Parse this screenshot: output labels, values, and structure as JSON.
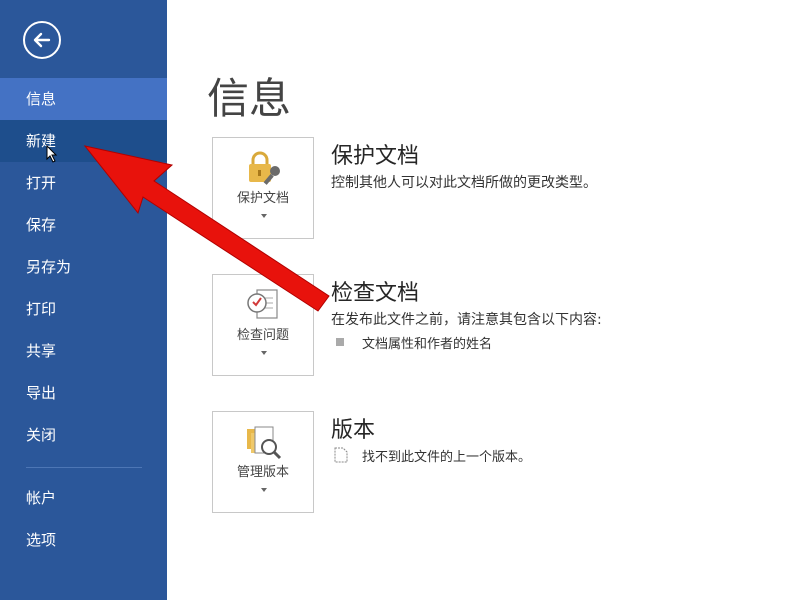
{
  "sidebar": {
    "items": [
      {
        "label": "信息"
      },
      {
        "label": "新建"
      },
      {
        "label": "打开"
      },
      {
        "label": "保存"
      },
      {
        "label": "另存为"
      },
      {
        "label": "打印"
      },
      {
        "label": "共享"
      },
      {
        "label": "导出"
      },
      {
        "label": "关闭"
      },
      {
        "label": "帐户"
      },
      {
        "label": "选项"
      }
    ]
  },
  "page": {
    "title": "信息"
  },
  "protect": {
    "card_label": "保护文档",
    "title": "保护文档",
    "description": "控制其他人可以对此文档所做的更改类型。"
  },
  "inspect": {
    "card_label": "检查问题",
    "title": "检查文档",
    "description": "在发布此文件之前，请注意其包含以下内容:",
    "bullets": [
      "文档属性和作者的姓名"
    ]
  },
  "versions": {
    "card_label": "管理版本",
    "title": "版本",
    "description": "找不到此文件的上一个版本。"
  },
  "colors": {
    "sidebar": "#2b579a",
    "active_item": "#4472c4",
    "annotation_arrow": "#e8120c"
  }
}
